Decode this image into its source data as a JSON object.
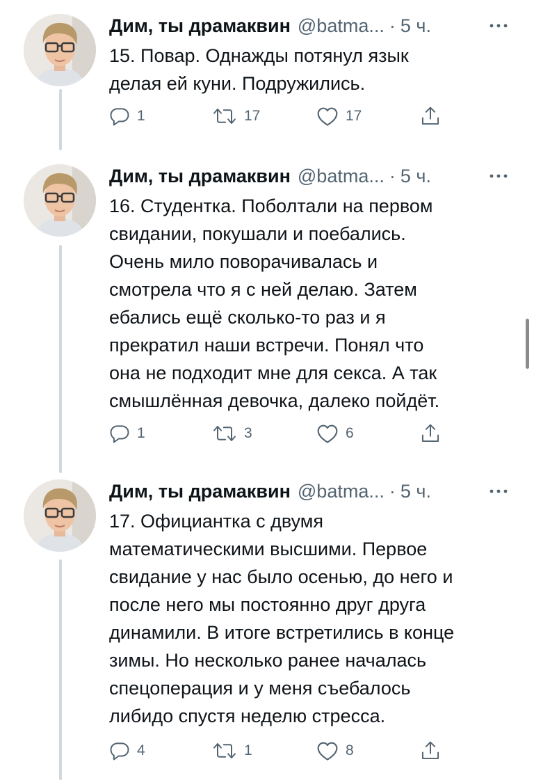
{
  "tweets": [
    {
      "author_name": "Дим, ты драмаквин",
      "handle": "@batma...",
      "dot": "·",
      "time": "5 ч.",
      "text": "15. Повар. Однажды потянул язык\nделая ей куни. Подружились.",
      "replies": "1",
      "retweets": "17",
      "likes": "17"
    },
    {
      "author_name": "Дим, ты драмаквин",
      "handle": "@batma...",
      "dot": "·",
      "time": "5 ч.",
      "text": "16. Студентка. Поболтали на первом\nсвидании, покушали и поебались.\nОчень мило поворачивалась и\nсмотрела что я с ней делаю. Затем\nебались ещё сколько-то раз и я\nпрекратил наши встречи. Понял что\nона не подходит мне для секса. А так\nсмышлённая девочка, далеко пойдёт.",
      "replies": "1",
      "retweets": "3",
      "likes": "6"
    },
    {
      "author_name": "Дим, ты драмаквин",
      "handle": "@batma...",
      "dot": "·",
      "time": "5 ч.",
      "text": "17. Официантка с двумя\nматематическими высшими. Первое\nсвидание у нас было осенью, до него и\nпосле него мы постоянно друг друга\nдинамили. В итоге встретились в конце\nзимы. Но несколько ранее началась\nспецоперация и у меня съебалось\nлибидо спустя неделю стресса.",
      "replies": "4",
      "retweets": "1",
      "likes": "8"
    }
  ],
  "icons": {
    "reply": "reply-icon",
    "retweet": "retweet-icon",
    "like": "heart-icon",
    "share": "share-icon",
    "more": "more-icon"
  },
  "colors": {
    "text": "#0f1419",
    "secondary": "#536471",
    "thread_line": "#cfd9de"
  }
}
